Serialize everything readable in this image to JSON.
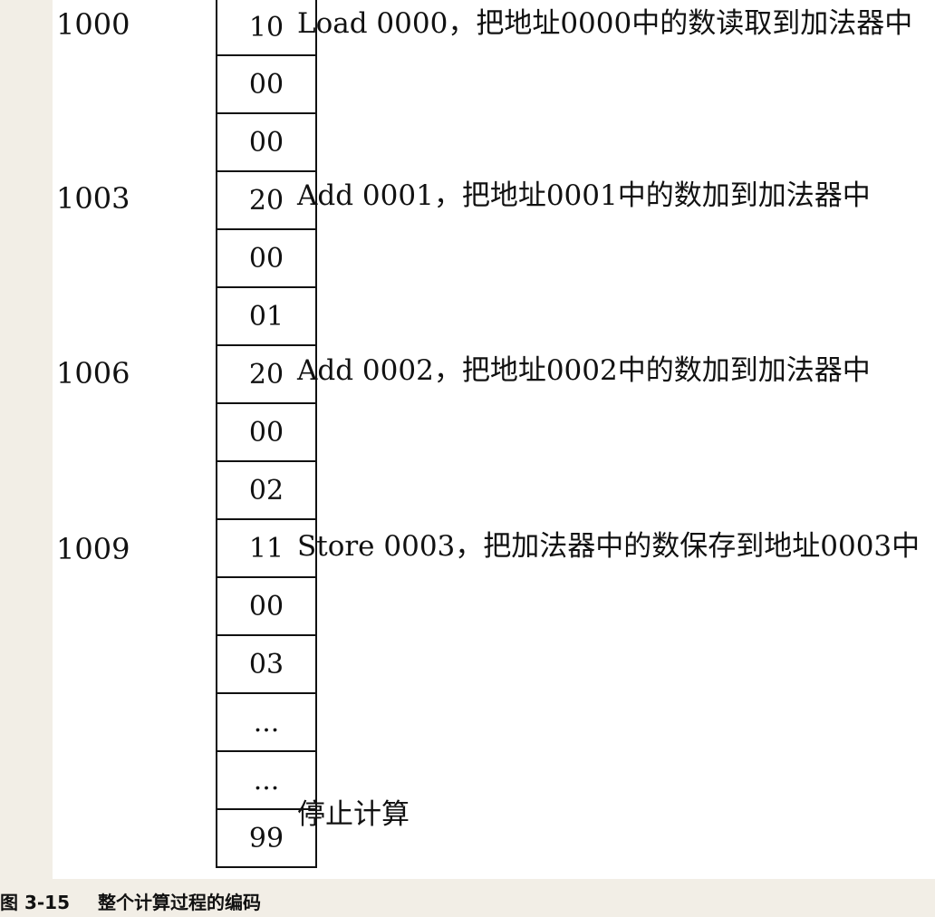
{
  "addresses": [
    {
      "label": "1000",
      "row": 0
    },
    {
      "label": "1003",
      "row": 3
    },
    {
      "label": "1006",
      "row": 6
    },
    {
      "label": "1009",
      "row": 9
    }
  ],
  "cells": [
    "10",
    "00",
    "00",
    "20",
    "00",
    "01",
    "20",
    "00",
    "02",
    "11",
    "00",
    "03",
    "...",
    "...",
    "99"
  ],
  "notes": [
    {
      "text": "Load 0000，把地址0000中的数读取到加法器中",
      "row": 0
    },
    {
      "text": "Add 0001，把地址0001中的数加到加法器中",
      "row": 3
    },
    {
      "text": "Add 0002，把地址0002中的数加到加法器中",
      "row": 6
    },
    {
      "text": "Store 0003，把加法器中的数保存到地址0003中",
      "row": 9
    },
    {
      "text": "停止计算",
      "row": 13.6
    }
  ],
  "caption": {
    "number": "图 3-15",
    "title": "整个计算过程的编码"
  }
}
